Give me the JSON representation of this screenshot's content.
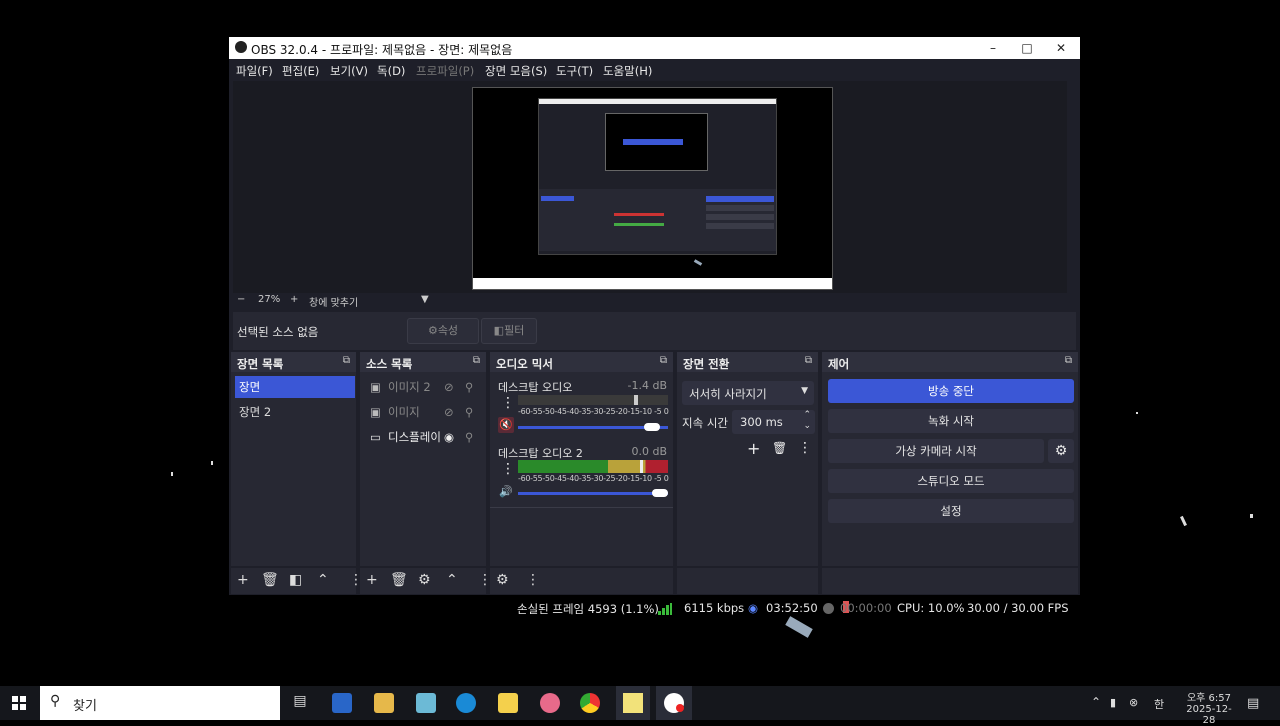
{
  "window": {
    "title": "OBS 32.0.4 - 프로파일: 제목없음 - 장면: 제목없음",
    "min_icon": "minimize-icon",
    "max_icon": "maximize-icon",
    "close_icon": "close-icon"
  },
  "menubar": {
    "items": [
      "파일(F)",
      "편집(E)",
      "보기(V)",
      "독(D)",
      "프로파일(P)",
      "장면 모음(S)",
      "도구(T)",
      "도움말(H)"
    ],
    "disabled_index": 4
  },
  "zoom": {
    "minus": "−",
    "value": "27%",
    "plus": "+",
    "fit_label": "창에 맞추기"
  },
  "context": {
    "no_source": "선택된 소스 없음",
    "properties": "속성",
    "filters": "필터"
  },
  "scenes": {
    "title": "장면 목록",
    "items": [
      "장면",
      "장면 2"
    ],
    "selected_index": 0
  },
  "sources": {
    "title": "소스 목록",
    "items": [
      {
        "label": "이미지 2",
        "visible": false,
        "icon": "image-icon"
      },
      {
        "label": "이미지",
        "visible": false,
        "icon": "image-icon"
      },
      {
        "label": "디스플레이",
        "visible": true,
        "icon": "display-icon"
      }
    ]
  },
  "mixer": {
    "title": "오디오 믹서",
    "channels": [
      {
        "name": "데스크탑 오디오",
        "db": "-1.4 dB",
        "muted": true,
        "level": 0.0
      },
      {
        "name": "데스크탑 오디오 2",
        "db": "0.0 dB",
        "muted": false,
        "level": 0.97
      }
    ],
    "ticks": "-60-55-50-45-40-35-30-25-20-15-10 -5  0"
  },
  "transitions": {
    "title": "장면 전환",
    "selected": "서서히 사라지기",
    "duration_label": "지속 시간",
    "duration_value": "300 ms"
  },
  "controls": {
    "title": "제어",
    "stop_stream": "방송 중단",
    "start_record": "녹화 시작",
    "start_vcam": "가상 카메라 시작",
    "studio_mode": "스튜디오 모드",
    "settings": "설정"
  },
  "status": {
    "dropped": "손실된 프레임 4593 (1.1%)",
    "bitrate": "6115 kbps",
    "stream_time": "03:52:50",
    "record_time": "00:00:00",
    "cpu": "CPU: 10.0%",
    "fps": "30.00 / 30.00 FPS"
  },
  "taskbar": {
    "search_placeholder": "찾기",
    "tray_lang": "한",
    "time": "오후 6:57",
    "date": "2025-12-28"
  },
  "colors": {
    "accent": "#3b57d6",
    "window_bg": "#1e1f29",
    "panel_bg": "#272833"
  }
}
